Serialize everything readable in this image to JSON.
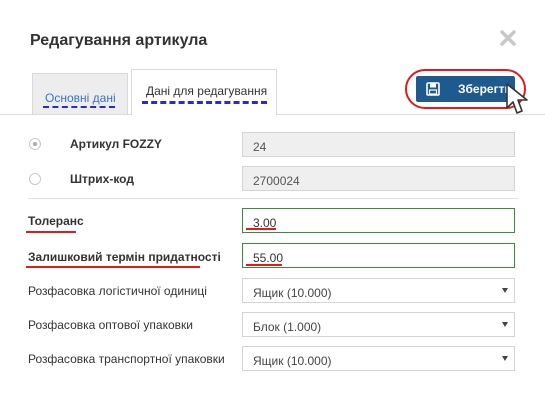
{
  "dialog": {
    "title": "Редагування артикула"
  },
  "tabs": [
    {
      "label": "Основні дані"
    },
    {
      "label": "Дані для редагування"
    }
  ],
  "save_button": {
    "label": "Зберегти"
  },
  "fields": {
    "article": {
      "label": "Артикул FOZZY",
      "value": "24"
    },
    "barcode": {
      "label": "Штрих-код",
      "value": "2700024"
    },
    "tolerance": {
      "label": "Толеранс",
      "value": "3.00"
    },
    "shelf_life": {
      "label": "Залишковий термін придатності",
      "value": "55.00"
    },
    "logistic_unit": {
      "label": "Розфасовка логістичної одиниці",
      "value": "Ящик (10.000)"
    },
    "wholesale_pack": {
      "label": "Розфасовка оптової упаковки",
      "value": "Блок (1.000)"
    },
    "transport_pack": {
      "label": "Розфасовка транспортної упаковки",
      "value": "Ящик (10.000)"
    }
  },
  "colors": {
    "accent": "#1f5a8e",
    "annotation": "#e01b1b",
    "valid": "#3c8b3c"
  }
}
